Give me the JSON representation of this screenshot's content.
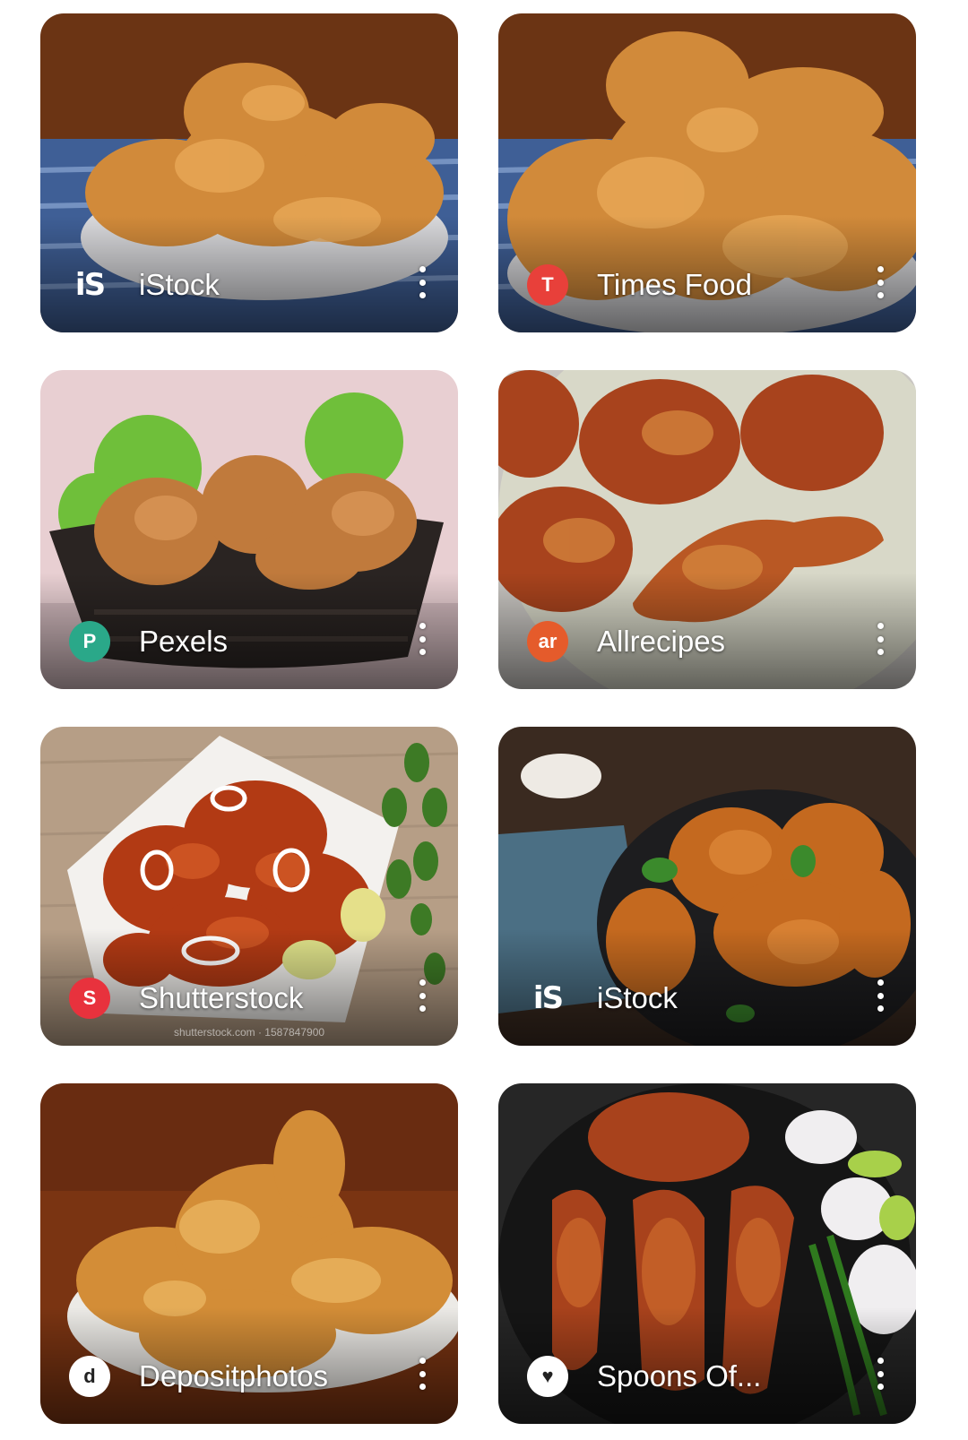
{
  "results": [
    {
      "source": "iStock",
      "badge_text": "iS",
      "badge_color": "#ffffff",
      "badge_style": "plain",
      "icon": "istock-logo-icon"
    },
    {
      "source": "Times Food",
      "badge_text": "T",
      "badge_color": "#e8403a",
      "badge_style": "round",
      "icon": "times-food-logo-icon"
    },
    {
      "source": "Pexels",
      "badge_text": "P",
      "badge_color": "#2aa889",
      "badge_style": "round",
      "icon": "pexels-logo-icon"
    },
    {
      "source": "Allrecipes",
      "badge_text": "ar",
      "badge_color": "#e55b2b",
      "badge_style": "round",
      "icon": "allrecipes-logo-icon"
    },
    {
      "source": "Shutterstock",
      "badge_text": "S",
      "badge_color": "#e8323d",
      "badge_style": "round",
      "icon": "shutterstock-logo-icon",
      "watermark": "shutterstock.com · 1587847900"
    },
    {
      "source": "iStock",
      "badge_text": "iS",
      "badge_color": "#ffffff",
      "badge_style": "plain",
      "icon": "istock-logo-icon"
    },
    {
      "source": "Depositphotos",
      "badge_text": "d",
      "badge_color": "#ffffff",
      "badge_style": "round",
      "icon": "depositphotos-logo-icon"
    },
    {
      "source": "Spoons Of...",
      "badge_text": "♥",
      "badge_color": "#ffffff",
      "badge_style": "round",
      "icon": "spoons-of-logo-icon"
    }
  ]
}
